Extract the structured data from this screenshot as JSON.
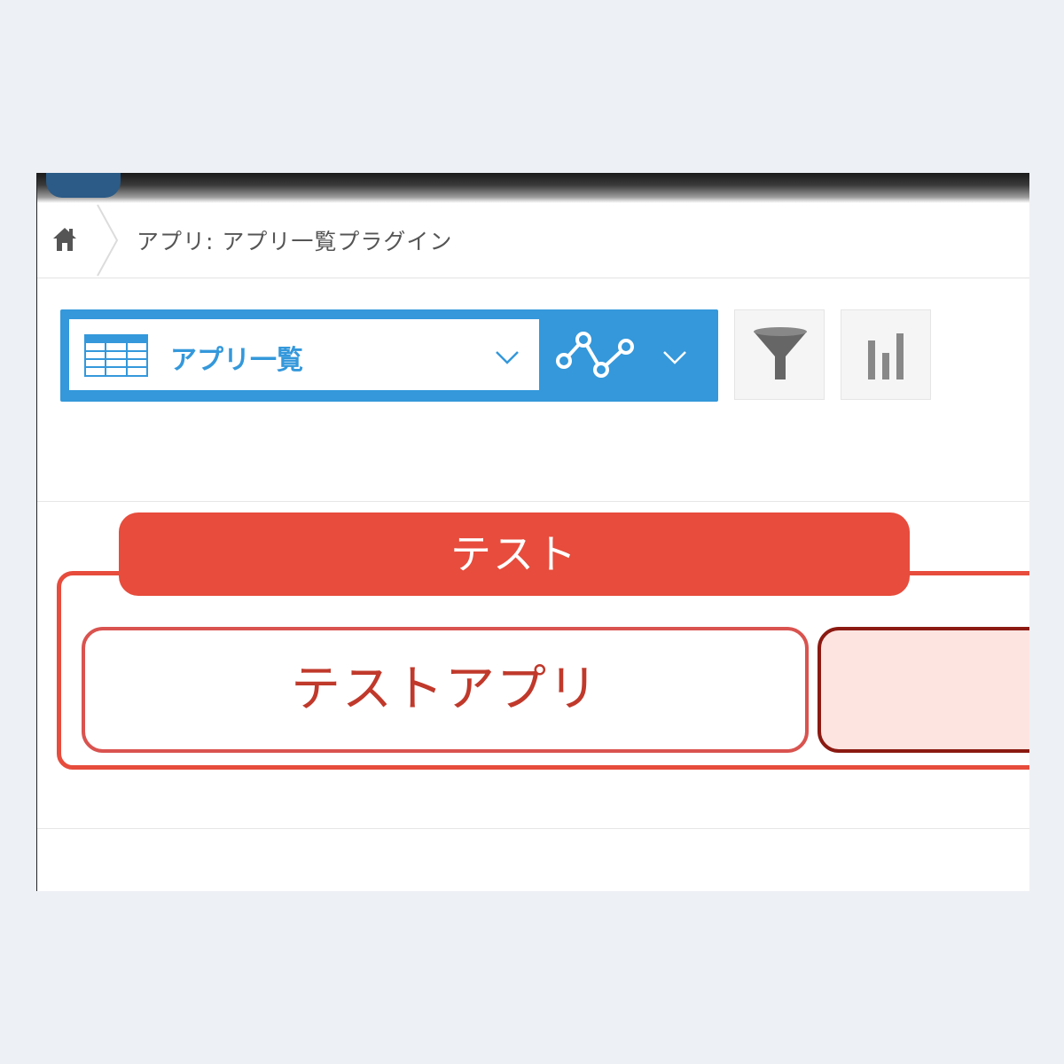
{
  "breadcrumb": {
    "home_icon": "home-icon",
    "path": "アプリ: アプリ一覧プラグイン"
  },
  "toolbar": {
    "view_label": "アプリ一覧",
    "view_icon": "table-icon",
    "graph_icon": "line-chart-icon",
    "filter_icon": "filter-icon",
    "chart_icon": "bar-chart-icon"
  },
  "group": {
    "title": "テスト",
    "apps": [
      {
        "name": "テストアプリ"
      },
      {
        "name": ""
      }
    ]
  },
  "colors": {
    "accent": "#3498db",
    "group_red": "#e74c3c",
    "tile_border": "#d9534f",
    "tile_selected_bg": "#fde4e1"
  }
}
